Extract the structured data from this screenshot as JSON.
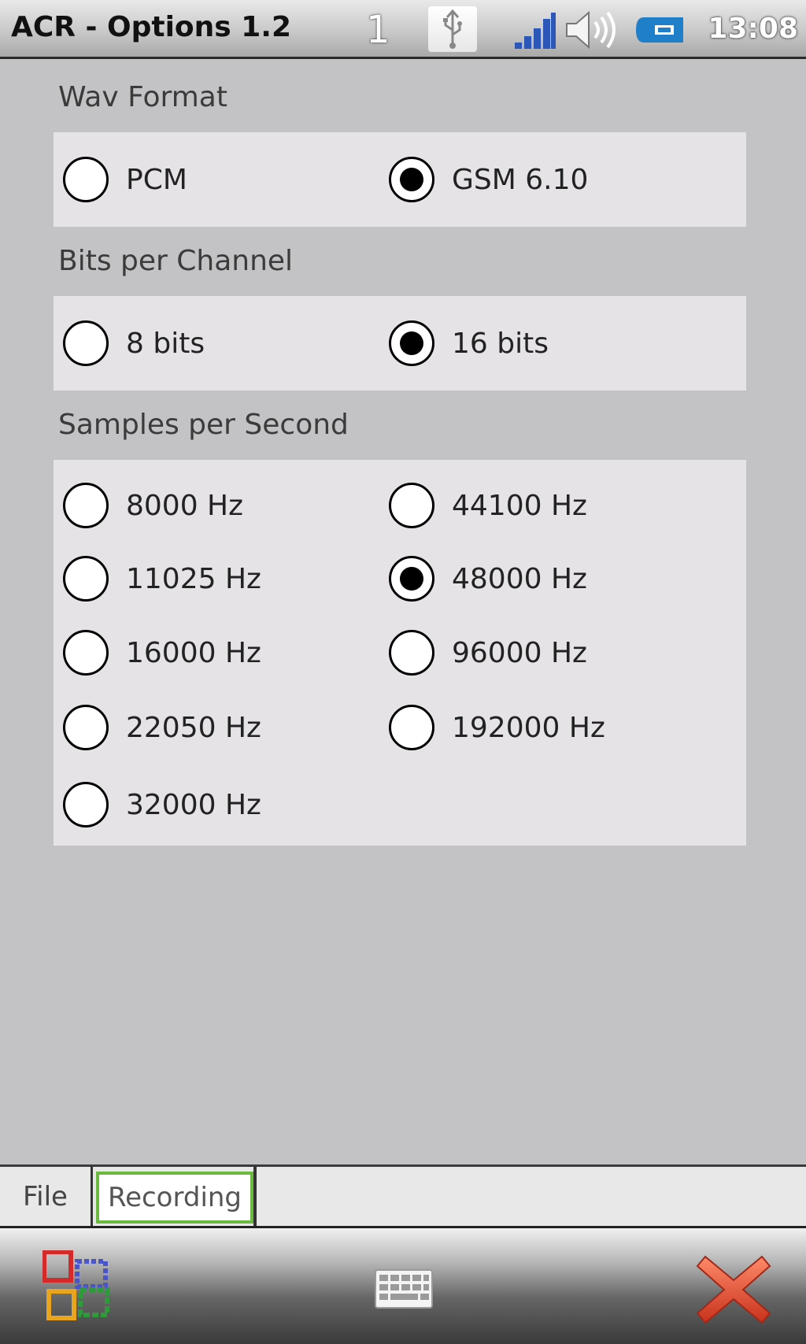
{
  "status_bar": {
    "title": "ACR - Options 1.2",
    "page_number": "1",
    "time": "13:08",
    "icons": [
      "usb-icon",
      "signal-icon",
      "speaker-icon",
      "battery-icon"
    ]
  },
  "sections": {
    "wav_format": {
      "title": "Wav Format",
      "options": [
        {
          "label": "PCM",
          "selected": false
        },
        {
          "label": "GSM 6.10",
          "selected": true
        }
      ]
    },
    "bits_per_channel": {
      "title": "Bits per Channel",
      "options": [
        {
          "label": "8 bits",
          "selected": false
        },
        {
          "label": "16 bits",
          "selected": true
        }
      ]
    },
    "samples_per_second": {
      "title": "Samples per Second",
      "options": [
        {
          "label": "8000 Hz",
          "selected": false
        },
        {
          "label": "44100 Hz",
          "selected": false
        },
        {
          "label": "11025 Hz",
          "selected": false
        },
        {
          "label": "48000 Hz",
          "selected": true
        },
        {
          "label": "16000 Hz",
          "selected": false
        },
        {
          "label": "96000 Hz",
          "selected": false
        },
        {
          "label": "22050 Hz",
          "selected": false
        },
        {
          "label": "192000 Hz",
          "selected": false
        },
        {
          "label": "32000 Hz",
          "selected": false
        }
      ]
    }
  },
  "tabs": [
    {
      "label": "File",
      "active": false
    },
    {
      "label": "Recording",
      "active": true
    }
  ],
  "bottom_bar": {
    "icons": [
      "start-icon",
      "keyboard-icon",
      "close-icon"
    ]
  },
  "colors": {
    "background": "#c3c2c5",
    "panel": "#e6e3e7",
    "active_tab_border": "#6bb93f",
    "close_red": "#e04a2a"
  }
}
